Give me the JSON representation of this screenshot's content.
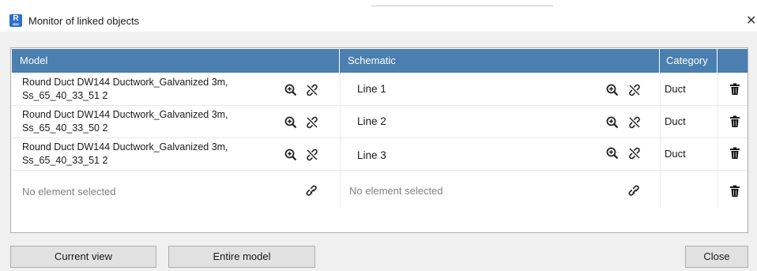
{
  "window": {
    "title": "Monitor of linked objects",
    "app_icon_letter": "R",
    "app_icon_sub": "BIM"
  },
  "table": {
    "headers": {
      "model": "Model",
      "schematic": "Schematic",
      "category": "Category"
    },
    "rows": [
      {
        "model_line1": "Round Duct DW144 Ductwork_Galvanized 3m,",
        "model_line2": "Ss_65_40_33_51 2",
        "schematic": "Line 1",
        "category": "Duct"
      },
      {
        "model_line1": "Round Duct DW144 Ductwork_Galvanized 3m,",
        "model_line2": "Ss_65_40_33_50 2",
        "schematic": "Line 2",
        "category": "Duct"
      },
      {
        "model_line1": "Round Duct DW144 Ductwork_Galvanized 3m,",
        "model_line2": "Ss_65_40_33_51 2",
        "schematic": "Line 3",
        "category": "Duct"
      }
    ],
    "empty_row": {
      "model": "No element selected",
      "schematic": "No element selected"
    }
  },
  "buttons": {
    "current_view": "Current view",
    "entire_model": "Entire model",
    "close": "Close"
  },
  "icons": {
    "zoom": "zoom-in-icon",
    "unlink": "unlink-icon",
    "link": "link-icon",
    "delete": "trash-icon"
  },
  "colors": {
    "header": "#4a7fb0",
    "app_icon": "#2f6fcf"
  }
}
